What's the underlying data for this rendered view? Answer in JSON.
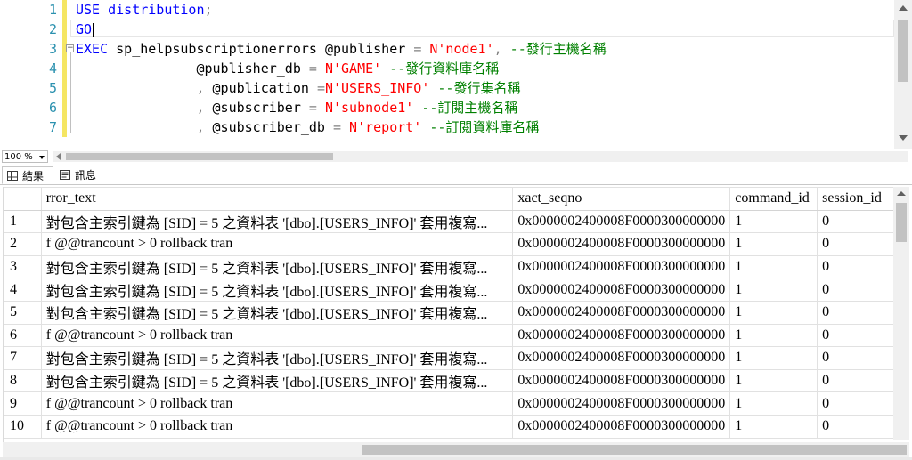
{
  "editor": {
    "line_numbers": [
      "1",
      "2",
      "3",
      "4",
      "5",
      "6",
      "7"
    ],
    "lines": [
      [
        {
          "t": "USE distribution",
          "c": "kw"
        },
        {
          "t": ";",
          "c": "op"
        }
      ],
      [
        {
          "t": "GO",
          "c": "kw"
        }
      ],
      [
        {
          "t": "EXEC ",
          "c": "kw"
        },
        {
          "t": "sp_helpsubscriptionerrors",
          "c": "pl"
        },
        {
          "t": " @publisher ",
          "c": "pl"
        },
        {
          "t": "=",
          "c": "op"
        },
        {
          "t": " N'node1'",
          "c": "str"
        },
        {
          "t": ",",
          "c": "op"
        },
        {
          "t": " --發行主機名稱",
          "c": "cm"
        }
      ],
      [
        {
          "t": "               @publisher_db ",
          "c": "pl"
        },
        {
          "t": "=",
          "c": "op"
        },
        {
          "t": " N'GAME'",
          "c": "str"
        },
        {
          "t": " --發行資料庫名稱",
          "c": "cm"
        }
      ],
      [
        {
          "t": "               ",
          "c": "pl"
        },
        {
          "t": ",",
          "c": "op"
        },
        {
          "t": " @publication ",
          "c": "pl"
        },
        {
          "t": "=",
          "c": "op"
        },
        {
          "t": "N'USERS_INFO'",
          "c": "str"
        },
        {
          "t": " --發行集名稱",
          "c": "cm"
        }
      ],
      [
        {
          "t": "               ",
          "c": "pl"
        },
        {
          "t": ",",
          "c": "op"
        },
        {
          "t": " @subscriber ",
          "c": "pl"
        },
        {
          "t": "=",
          "c": "op"
        },
        {
          "t": " N'subnode1'",
          "c": "str"
        },
        {
          "t": " --訂閱主機名稱",
          "c": "cm"
        }
      ],
      [
        {
          "t": "               ",
          "c": "pl"
        },
        {
          "t": ",",
          "c": "op"
        },
        {
          "t": " @subscriber_db ",
          "c": "pl"
        },
        {
          "t": "=",
          "c": "op"
        },
        {
          "t": " N'report'",
          "c": "str"
        },
        {
          "t": " --訂閱資料庫名稱",
          "c": "cm"
        }
      ]
    ],
    "colors": {
      "keyword": "#0000ff",
      "string": "#ff0000",
      "comment": "#008000",
      "operator": "#808080",
      "line_number": "#2b91af"
    }
  },
  "zoom": {
    "value": "100 %"
  },
  "tabs": {
    "results": "結果",
    "messages": "訊息"
  },
  "results": {
    "columns": [
      "",
      "rror_text",
      "xact_seqno",
      "command_id",
      "session_id"
    ],
    "rows": [
      [
        "1",
        "對包含主索引鍵為 [SID] = 5 之資料表 '[dbo].[USERS_INFO]' 套用複寫...",
        "0x0000002400008F0000300000000",
        "1",
        "0"
      ],
      [
        "2",
        "f @@trancount > 0 rollback tran",
        "0x0000002400008F0000300000000",
        "1",
        "0"
      ],
      [
        "3",
        "對包含主索引鍵為 [SID] = 5 之資料表 '[dbo].[USERS_INFO]' 套用複寫...",
        "0x0000002400008F0000300000000",
        "1",
        "0"
      ],
      [
        "4",
        "對包含主索引鍵為 [SID] = 5 之資料表 '[dbo].[USERS_INFO]' 套用複寫...",
        "0x0000002400008F0000300000000",
        "1",
        "0"
      ],
      [
        "5",
        "對包含主索引鍵為 [SID] = 5 之資料表 '[dbo].[USERS_INFO]' 套用複寫...",
        "0x0000002400008F0000300000000",
        "1",
        "0"
      ],
      [
        "6",
        "f @@trancount > 0 rollback tran",
        "0x0000002400008F0000300000000",
        "1",
        "0"
      ],
      [
        "7",
        "對包含主索引鍵為 [SID] = 5 之資料表 '[dbo].[USERS_INFO]' 套用複寫...",
        "0x0000002400008F0000300000000",
        "1",
        "0"
      ],
      [
        "8",
        "對包含主索引鍵為 [SID] = 5 之資料表 '[dbo].[USERS_INFO]' 套用複寫...",
        "0x0000002400008F0000300000000",
        "1",
        "0"
      ],
      [
        "9",
        "f @@trancount > 0 rollback tran",
        "0x0000002400008F0000300000000",
        "1",
        "0"
      ],
      [
        "10",
        "f @@trancount > 0 rollback tran",
        "0x0000002400008F0000300000000",
        "1",
        "0"
      ]
    ]
  }
}
